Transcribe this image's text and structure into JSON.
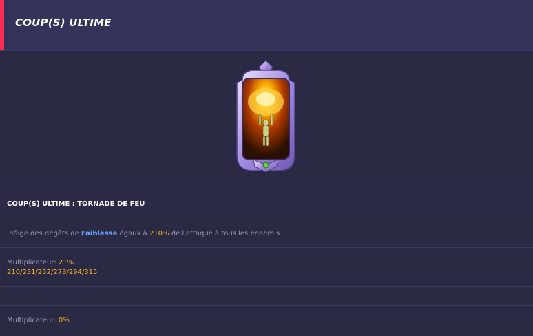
{
  "header": {
    "title": "COUP(S) ULTIME"
  },
  "skill": {
    "name": "COUP(S) ULTIME : TORNADE DE FEU",
    "desc_prefix": "Inflige des dégâts de ",
    "desc_keyword": "Faiblesse",
    "desc_middle": " égaux à ",
    "desc_percent": "210%",
    "desc_suffix": " de l'attaque à tous les ennemis.",
    "multiplier_label": "Multiplicateur: ",
    "multiplier_value": "21%",
    "levels": "210/231/252/273/294/315",
    "multiplier2_label": "Multiplicateur: ",
    "multiplier2_value": "0%"
  },
  "colors": {
    "accent": "#ff2a55",
    "keyword": "#6aa6ff",
    "highlight": "#ffb020",
    "frame": "#c9b8ff"
  }
}
